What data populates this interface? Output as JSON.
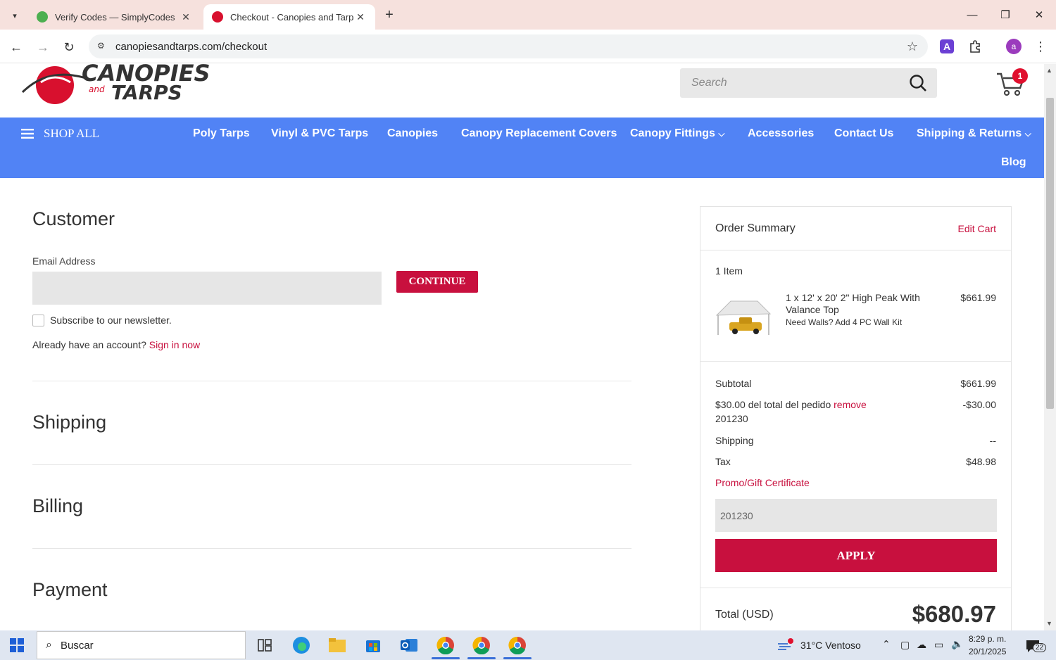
{
  "browser": {
    "tabs": [
      {
        "title": "Verify Codes — SimplyCodes",
        "active": false,
        "favicon_color": "#4caf50"
      },
      {
        "title": "Checkout - Canopies and Tarps",
        "active": true,
        "favicon_color": "#d8102e"
      }
    ],
    "url": "canopiesandtarps.com/checkout",
    "profile_initial": "a",
    "extension_label": "A"
  },
  "header": {
    "logo_line1": "CANOPIES",
    "logo_and": "and",
    "logo_line2": "TARPS",
    "search_placeholder": "Search",
    "cart_count": "1"
  },
  "nav": {
    "shop_all": "SHOP ALL",
    "items": [
      "Poly Tarps",
      "Vinyl & PVC Tarps",
      "Canopies",
      "Canopy Replacement Covers",
      "Canopy Fittings",
      "Accessories",
      "Contact Us",
      "Shipping & Returns",
      "Blog"
    ]
  },
  "checkout": {
    "customer_title": "Customer",
    "email_label": "Email Address",
    "continue_label": "CONTINUE",
    "newsletter_label": "Subscribe to our newsletter.",
    "account_prompt": "Already have an account?",
    "sign_in_label": "Sign in now",
    "shipping_title": "Shipping",
    "billing_title": "Billing",
    "payment_title": "Payment"
  },
  "summary": {
    "title": "Order Summary",
    "edit_cart": "Edit Cart",
    "item_count": "1 Item",
    "product_name": "1 x 12' x 20' 2\" High Peak With Valance Top",
    "product_option": "Need Walls? Add 4 PC Wall Kit",
    "product_price": "$661.99",
    "subtotal_label": "Subtotal",
    "subtotal_value": "$661.99",
    "discount_label": "$30.00 del total del pedido",
    "discount_remove": "remove",
    "discount_code": "201230",
    "discount_value": "-$30.00",
    "shipping_label": "Shipping",
    "shipping_value": "--",
    "tax_label": "Tax",
    "tax_value": "$48.98",
    "promo_label": "Promo/Gift Certificate",
    "promo_value": "201230",
    "apply_label": "APPLY",
    "total_label": "Total (USD)",
    "total_value": "$680.97"
  },
  "taskbar": {
    "search_placeholder": "Buscar",
    "weather": "31°C  Ventoso",
    "time": "8:29 p. m.",
    "date": "20/1/2025",
    "notifications": "22"
  },
  "colors": {
    "nav_blue": "#5183f5",
    "brand_red": "#c8103e",
    "tabbar": "#f6e1dd"
  }
}
